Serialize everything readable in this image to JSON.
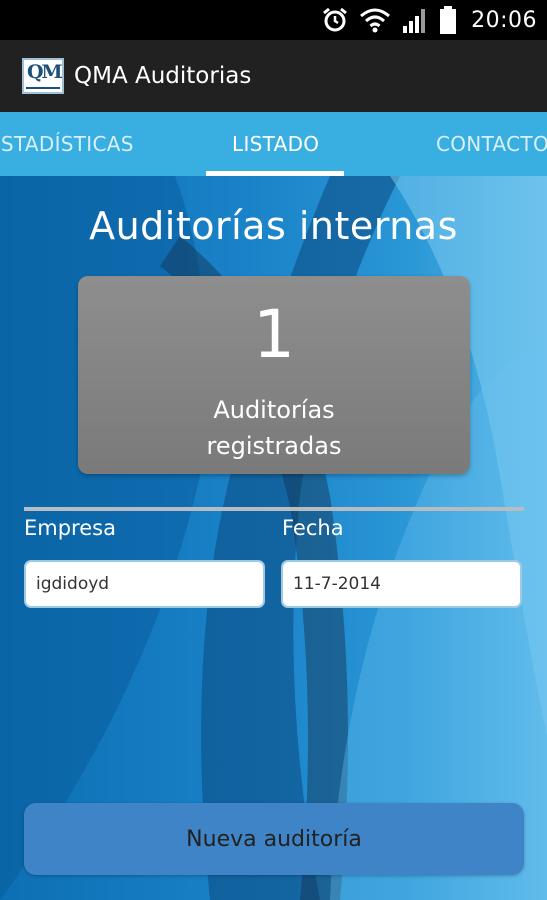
{
  "status_bar": {
    "time": "20:06",
    "icons": [
      "alarm-icon",
      "wifi-icon",
      "signal-icon",
      "battery-icon"
    ]
  },
  "action_bar": {
    "logo_text": "QMA",
    "title": "QMA Auditorias"
  },
  "tabs": [
    {
      "label": "Estadísticas",
      "selected": false
    },
    {
      "label": "Listado",
      "selected": true
    },
    {
      "label": "Contacto",
      "selected": false
    }
  ],
  "main": {
    "title": "Auditorías internas",
    "stat": {
      "count": "1",
      "label_line1": "Auditorías",
      "label_line2": "registradas"
    },
    "form": {
      "empresa_label": "Empresa",
      "empresa_value": "igdidoyd",
      "fecha_label": "Fecha",
      "fecha_value": "11-7-2014"
    },
    "new_button_label": "Nueva auditoría"
  },
  "colors": {
    "tab_bar": "#39aee0",
    "action_bar": "#212121",
    "stat_card": "#858585",
    "button": "#3e84c6"
  }
}
